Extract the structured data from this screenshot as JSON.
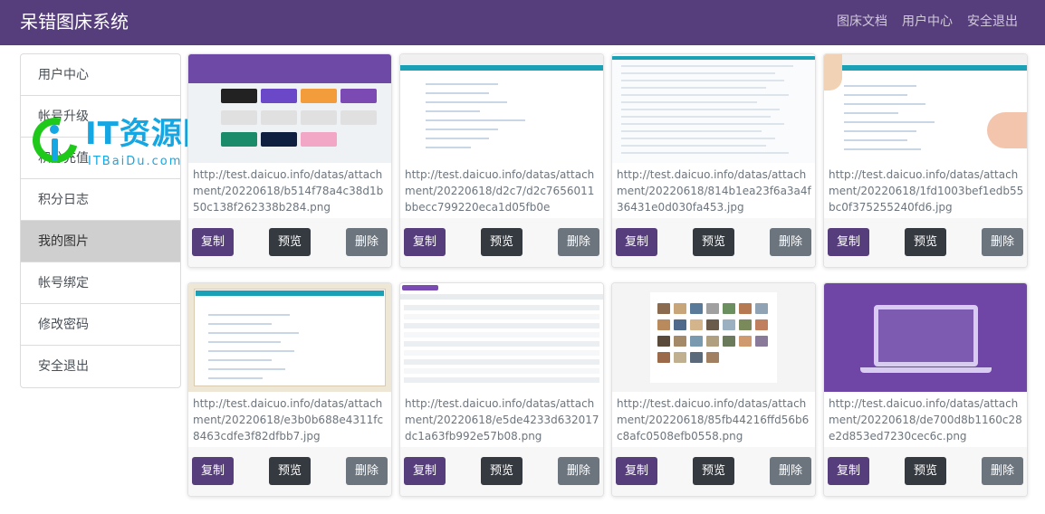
{
  "app": {
    "title": "呆错图床系统"
  },
  "nav": {
    "links": [
      "图床文档",
      "用户中心",
      "安全退出"
    ]
  },
  "sidebar": {
    "items": [
      {
        "label": "用户中心"
      },
      {
        "label": "帐号升级"
      },
      {
        "label": "积分充值"
      },
      {
        "label": "积分日志"
      },
      {
        "label": "我的图片"
      },
      {
        "label": "帐号绑定"
      },
      {
        "label": "修改密码"
      },
      {
        "label": "安全退出"
      }
    ],
    "active_label": "我的图片"
  },
  "watermark": {
    "main": "IT资源网",
    "sub": "ITBaiDu.com"
  },
  "actions": {
    "copy": "复制",
    "preview": "预览",
    "delete": "删除"
  },
  "images": [
    {
      "url": "http://test.daicuo.info/datas/attachment/20220618/b514f78a4c38d1b50c138f262338b284.png",
      "thumb": "purple-dashboard"
    },
    {
      "url": "http://test.daicuo.info/datas/attachment/20220618/d2c7/d2c7656011bbecc799220eca1d05fb0e",
      "thumb": "teal-list"
    },
    {
      "url": "http://test.daicuo.info/datas/attachment/20220618/814b1ea23f6a3a4f36431e0d030fa453.jpg",
      "thumb": "teal-dense"
    },
    {
      "url": "http://test.daicuo.info/datas/attachment/20220618/1fd1003bef1edb55bc0f375255240fd6.jpg",
      "thumb": "teal-list-peach"
    },
    {
      "url": "http://test.daicuo.info/datas/attachment/20220618/e3b0b688e4311fc8463cdfe3f82dfbb7.jpg",
      "thumb": "teal-list-framed"
    },
    {
      "url": "http://test.daicuo.info/datas/attachment/20220618/e5de4233d632017dc1a63fb992e57b08.png",
      "thumb": "table"
    },
    {
      "url": "http://test.daicuo.info/datas/attachment/20220618/85fb44216ffd56b6c8afc0508efb0558.png",
      "thumb": "tile-grid"
    },
    {
      "url": "http://test.daicuo.info/datas/attachment/20220618/de700d8b1160c28e2d853ed7230cec6c.png",
      "thumb": "laptop"
    }
  ]
}
